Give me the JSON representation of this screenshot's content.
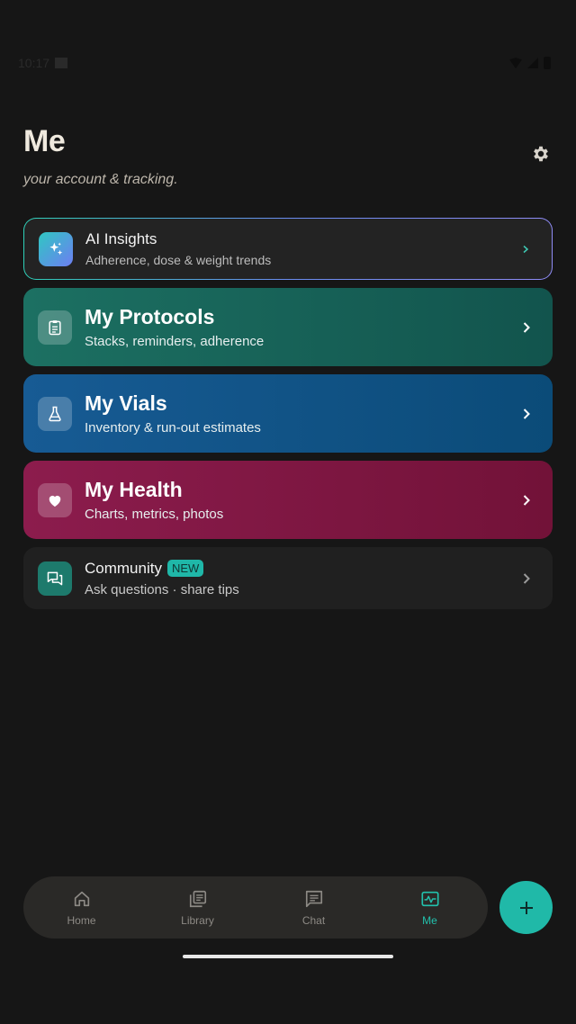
{
  "status_bar": {
    "time": "10:17"
  },
  "header": {
    "title": "Me",
    "subtitle": "your account & tracking."
  },
  "cards": {
    "ai": {
      "title": "AI Insights",
      "subtitle": "Adherence, dose & weight trends"
    },
    "protocols": {
      "title": "My Protocols",
      "subtitle": "Stacks, reminders, adherence"
    },
    "vials": {
      "title": "My Vials",
      "subtitle": "Inventory & run-out estimates"
    },
    "health": {
      "title": "My Health",
      "subtitle": "Charts, metrics, photos"
    },
    "community": {
      "title": "Community",
      "badge": "NEW",
      "subtitle": "Ask questions · share tips"
    }
  },
  "nav": {
    "items": [
      {
        "label": "Home",
        "icon": "home-icon"
      },
      {
        "label": "Library",
        "icon": "library-icon"
      },
      {
        "label": "Chat",
        "icon": "chat-icon"
      },
      {
        "label": "Me",
        "icon": "activity-icon",
        "active": true
      }
    ]
  },
  "colors": {
    "accent": "#20b9a8",
    "protocols": "#1c7062",
    "vials": "#175b94",
    "health": "#8c1c4d",
    "background": "#161616"
  }
}
